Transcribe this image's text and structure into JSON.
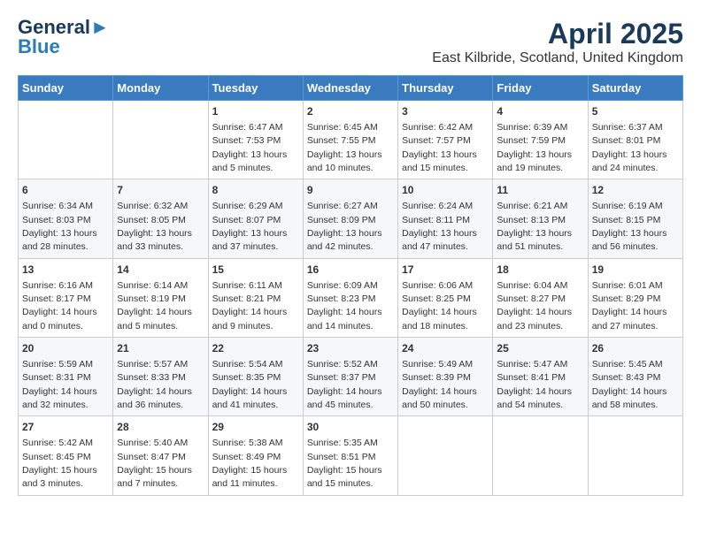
{
  "logo": {
    "line1": "General",
    "line2": "Blue"
  },
  "title": "April 2025",
  "subtitle": "East Kilbride, Scotland, United Kingdom",
  "days_of_week": [
    "Sunday",
    "Monday",
    "Tuesday",
    "Wednesday",
    "Thursday",
    "Friday",
    "Saturday"
  ],
  "weeks": [
    [
      {
        "day": "",
        "info": ""
      },
      {
        "day": "",
        "info": ""
      },
      {
        "day": "1",
        "info": "Sunrise: 6:47 AM\nSunset: 7:53 PM\nDaylight: 13 hours and 5 minutes."
      },
      {
        "day": "2",
        "info": "Sunrise: 6:45 AM\nSunset: 7:55 PM\nDaylight: 13 hours and 10 minutes."
      },
      {
        "day": "3",
        "info": "Sunrise: 6:42 AM\nSunset: 7:57 PM\nDaylight: 13 hours and 15 minutes."
      },
      {
        "day": "4",
        "info": "Sunrise: 6:39 AM\nSunset: 7:59 PM\nDaylight: 13 hours and 19 minutes."
      },
      {
        "day": "5",
        "info": "Sunrise: 6:37 AM\nSunset: 8:01 PM\nDaylight: 13 hours and 24 minutes."
      }
    ],
    [
      {
        "day": "6",
        "info": "Sunrise: 6:34 AM\nSunset: 8:03 PM\nDaylight: 13 hours and 28 minutes."
      },
      {
        "day": "7",
        "info": "Sunrise: 6:32 AM\nSunset: 8:05 PM\nDaylight: 13 hours and 33 minutes."
      },
      {
        "day": "8",
        "info": "Sunrise: 6:29 AM\nSunset: 8:07 PM\nDaylight: 13 hours and 37 minutes."
      },
      {
        "day": "9",
        "info": "Sunrise: 6:27 AM\nSunset: 8:09 PM\nDaylight: 13 hours and 42 minutes."
      },
      {
        "day": "10",
        "info": "Sunrise: 6:24 AM\nSunset: 8:11 PM\nDaylight: 13 hours and 47 minutes."
      },
      {
        "day": "11",
        "info": "Sunrise: 6:21 AM\nSunset: 8:13 PM\nDaylight: 13 hours and 51 minutes."
      },
      {
        "day": "12",
        "info": "Sunrise: 6:19 AM\nSunset: 8:15 PM\nDaylight: 13 hours and 56 minutes."
      }
    ],
    [
      {
        "day": "13",
        "info": "Sunrise: 6:16 AM\nSunset: 8:17 PM\nDaylight: 14 hours and 0 minutes."
      },
      {
        "day": "14",
        "info": "Sunrise: 6:14 AM\nSunset: 8:19 PM\nDaylight: 14 hours and 5 minutes."
      },
      {
        "day": "15",
        "info": "Sunrise: 6:11 AM\nSunset: 8:21 PM\nDaylight: 14 hours and 9 minutes."
      },
      {
        "day": "16",
        "info": "Sunrise: 6:09 AM\nSunset: 8:23 PM\nDaylight: 14 hours and 14 minutes."
      },
      {
        "day": "17",
        "info": "Sunrise: 6:06 AM\nSunset: 8:25 PM\nDaylight: 14 hours and 18 minutes."
      },
      {
        "day": "18",
        "info": "Sunrise: 6:04 AM\nSunset: 8:27 PM\nDaylight: 14 hours and 23 minutes."
      },
      {
        "day": "19",
        "info": "Sunrise: 6:01 AM\nSunset: 8:29 PM\nDaylight: 14 hours and 27 minutes."
      }
    ],
    [
      {
        "day": "20",
        "info": "Sunrise: 5:59 AM\nSunset: 8:31 PM\nDaylight: 14 hours and 32 minutes."
      },
      {
        "day": "21",
        "info": "Sunrise: 5:57 AM\nSunset: 8:33 PM\nDaylight: 14 hours and 36 minutes."
      },
      {
        "day": "22",
        "info": "Sunrise: 5:54 AM\nSunset: 8:35 PM\nDaylight: 14 hours and 41 minutes."
      },
      {
        "day": "23",
        "info": "Sunrise: 5:52 AM\nSunset: 8:37 PM\nDaylight: 14 hours and 45 minutes."
      },
      {
        "day": "24",
        "info": "Sunrise: 5:49 AM\nSunset: 8:39 PM\nDaylight: 14 hours and 50 minutes."
      },
      {
        "day": "25",
        "info": "Sunrise: 5:47 AM\nSunset: 8:41 PM\nDaylight: 14 hours and 54 minutes."
      },
      {
        "day": "26",
        "info": "Sunrise: 5:45 AM\nSunset: 8:43 PM\nDaylight: 14 hours and 58 minutes."
      }
    ],
    [
      {
        "day": "27",
        "info": "Sunrise: 5:42 AM\nSunset: 8:45 PM\nDaylight: 15 hours and 3 minutes."
      },
      {
        "day": "28",
        "info": "Sunrise: 5:40 AM\nSunset: 8:47 PM\nDaylight: 15 hours and 7 minutes."
      },
      {
        "day": "29",
        "info": "Sunrise: 5:38 AM\nSunset: 8:49 PM\nDaylight: 15 hours and 11 minutes."
      },
      {
        "day": "30",
        "info": "Sunrise: 5:35 AM\nSunset: 8:51 PM\nDaylight: 15 hours and 15 minutes."
      },
      {
        "day": "",
        "info": ""
      },
      {
        "day": "",
        "info": ""
      },
      {
        "day": "",
        "info": ""
      }
    ]
  ]
}
